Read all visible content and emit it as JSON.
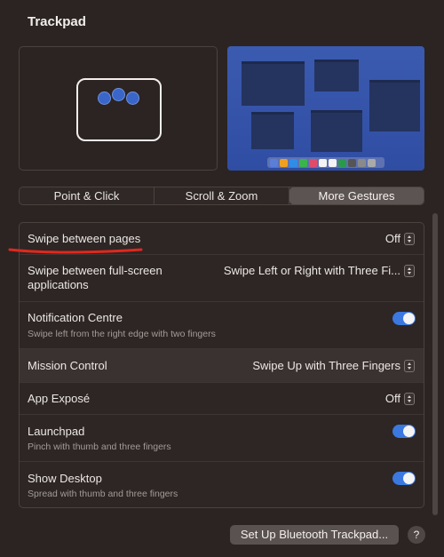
{
  "window": {
    "title": "Trackpad"
  },
  "tabs": [
    {
      "label": "Point & Click",
      "active": false
    },
    {
      "label": "Scroll & Zoom",
      "active": false
    },
    {
      "label": "More Gestures",
      "active": true
    }
  ],
  "settings": [
    {
      "label": "Swipe between pages",
      "control": "select",
      "value": "Off"
    },
    {
      "label": "Swipe between full-screen applications",
      "control": "select",
      "value": "Swipe Left or Right with Three Fi..."
    },
    {
      "label": "Notification Centre",
      "sub": "Swipe left from the right edge with two fingers",
      "control": "toggle",
      "on": true
    },
    {
      "label": "Mission Control",
      "control": "select",
      "value": "Swipe Up with Three Fingers"
    },
    {
      "label": "App Exposé",
      "control": "select",
      "value": "Off"
    },
    {
      "label": "Launchpad",
      "sub": "Pinch with thumb and three fingers",
      "control": "toggle",
      "on": true
    },
    {
      "label": "Show Desktop",
      "sub": "Spread with thumb and three fingers",
      "control": "toggle",
      "on": true
    }
  ],
  "footer": {
    "setup_label": "Set Up Bluetooth Trackpad...",
    "help_label": "?"
  },
  "colors": {
    "accent": "#3b78e0",
    "annotation": "#e0281e",
    "background": "#2b2422"
  },
  "icons": [
    "trackpad-gesture-icon",
    "stepper-icon",
    "help-icon"
  ]
}
